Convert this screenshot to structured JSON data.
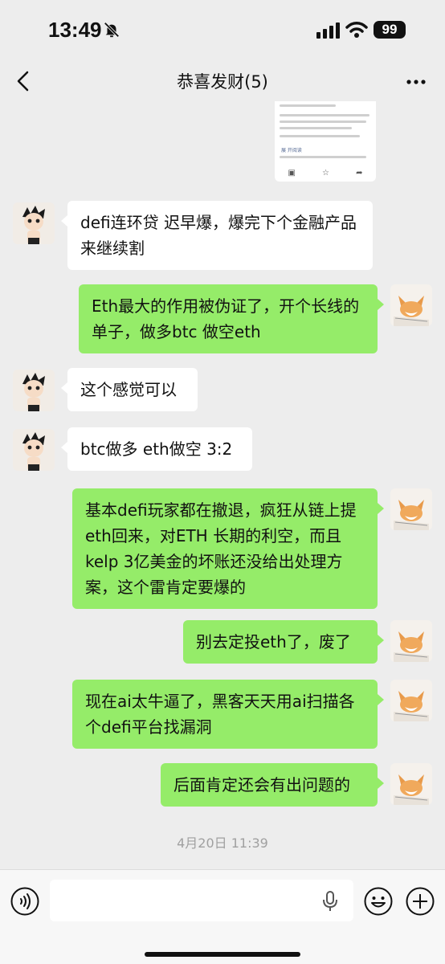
{
  "status_bar": {
    "time": "13:49",
    "battery": "99"
  },
  "header": {
    "title": "恭喜发财(5)"
  },
  "messages": [
    {
      "text": "defi连环贷 迟早爆，爆完下个金融产品来继续割"
    },
    {
      "text": "Eth最大的作用被伪证了，开个长线的单子，做多btc 做空eth"
    },
    {
      "text": "这个感觉可以"
    },
    {
      "text": "btc做多 eth做空 3:2"
    },
    {
      "text": "基本defi玩家都在撤退，疯狂从链上提eth回来，对ETH 长期的利空，而且kelp 3亿美金的坏账还没给出处理方案，这个雷肯定要爆的"
    },
    {
      "text": "别去定投eth了，废了"
    },
    {
      "text": "现在ai太牛逼了，黑客天天用ai扫描各个defi平台找漏洞"
    },
    {
      "text": "后面肯定还会有出问题的"
    }
  ],
  "shared_card": {
    "link_text": "展 开阅读"
  },
  "timestamp": "4月20日 11:39",
  "input": {
    "placeholder": ""
  },
  "colors": {
    "background": "#ededed",
    "outgoing_bubble": "#95ec69",
    "incoming_bubble": "#ffffff"
  }
}
